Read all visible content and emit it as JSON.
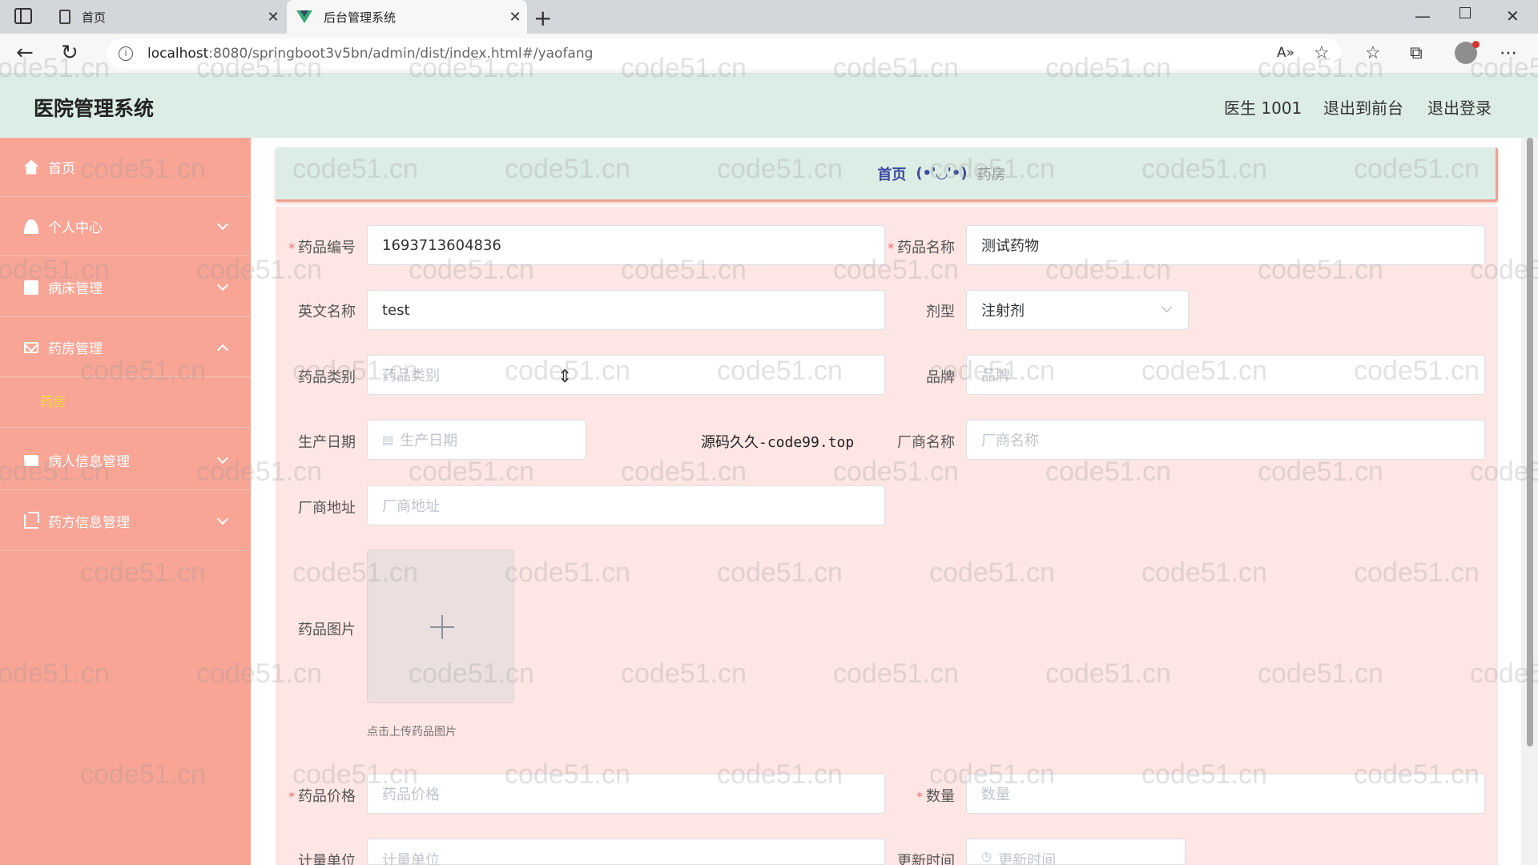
{
  "browser": {
    "tabs": [
      {
        "label": "首页"
      },
      {
        "label": "后台管理系统"
      }
    ],
    "tab_close_glyph": "✕",
    "new_tab_glyph": "+",
    "url_host": "localhost",
    "url_rest": ":8080/springboot3v5bn/admin/dist/index.html#/yaofang",
    "info_glyph": "i",
    "back_glyph": "←",
    "reload_glyph": "↻",
    "minimize_glyph": "—",
    "close_glyph": "✕",
    "toolbar_glyphs": {
      "read_aloud": "A»",
      "favorite_add": "☆",
      "favorites": "☆",
      "collections": "⧉",
      "more": "⋯"
    }
  },
  "header": {
    "title": "医院管理系统",
    "user": "医生 1001",
    "front_link": "退出到前台",
    "logout_link": "退出登录"
  },
  "sidebar": {
    "items": [
      {
        "label": "首页"
      },
      {
        "label": "个人中心"
      },
      {
        "label": "病床管理"
      },
      {
        "label": "药房管理"
      },
      {
        "label": "病人信息管理"
      },
      {
        "label": "药方信息管理"
      }
    ],
    "sub_item": "药房"
  },
  "breadcrumb": {
    "home": "首页",
    "separator": "(•'◡'•)",
    "current": "药房"
  },
  "form": {
    "drug_code": {
      "label": "药品编号",
      "value": "1693713604836"
    },
    "drug_name": {
      "label": "药品名称",
      "value": "测试药物"
    },
    "english_name": {
      "label": "英文名称",
      "value": "test"
    },
    "dosage_form": {
      "label": "剂型",
      "value": "注射剂"
    },
    "category": {
      "label": "药品类别",
      "placeholder": "药品类别"
    },
    "brand": {
      "label": "品牌",
      "placeholder": "品牌"
    },
    "production_date": {
      "label": "生产日期",
      "placeholder": "生产日期",
      "icon": "▤"
    },
    "manufacturer": {
      "label": "厂商名称",
      "placeholder": "厂商名称"
    },
    "manufacturer_address": {
      "label": "厂商地址",
      "placeholder": "厂商地址"
    },
    "image": {
      "label": "药品图片",
      "tip": "点击上传药品图片"
    },
    "price": {
      "label": "药品价格",
      "placeholder": "药品价格"
    },
    "quantity": {
      "label": "数量",
      "placeholder": "数量"
    },
    "unit": {
      "label": "计量单位",
      "placeholder": "计量单位"
    },
    "update_time": {
      "label": "更新时间",
      "placeholder": "更新时间",
      "icon": "◷"
    }
  },
  "overlay_text": "源码久久-code99.top",
  "watermark": "code51.cn",
  "cursor_glyph": "⇕",
  "colors": {
    "sidebar_bg": "#f8a596",
    "header_bg": "#dcede5",
    "form_bg": "#fde6e3",
    "active_submenu": "#f5d742",
    "breadcrumb_link": "#3b4a9e",
    "required_mark": "#f56c6c"
  }
}
